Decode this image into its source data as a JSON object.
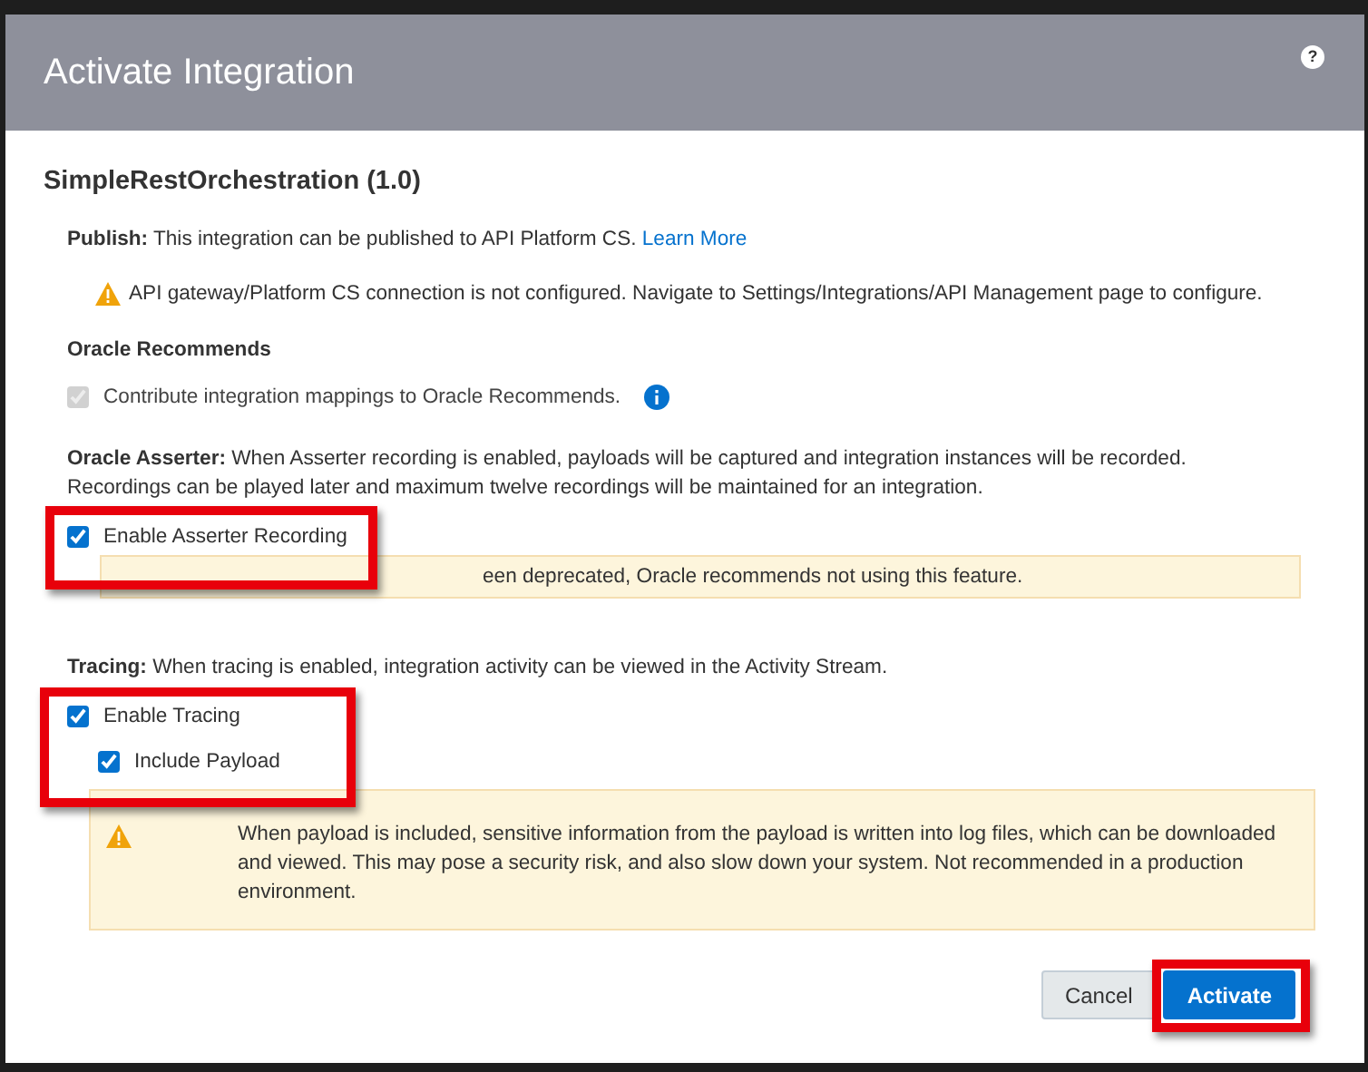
{
  "dialog": {
    "title": "Activate Integration",
    "help_icon": "?",
    "integration_name": "SimpleRestOrchestration (1.0)",
    "publish": {
      "text": "**Publish:** This integration can be published to API Platform CS.",
      "link": "Learn More",
      "warning": "API gateway/Platform CS connection is not configured. Navigate to Settings/Integrations/API Management page to configure."
    },
    "oracle_recommends": {
      "heading": "Oracle Recommends",
      "option": {
        "label": "Contribute integration mappings to Oracle Recommends.",
        "checked": true,
        "disabled": true
      }
    },
    "asserter": {
      "text": "**Oracle Asserter:** When Asserter recording is enabled, payloads will be captured and integration instances will be recorded. Recordings can be played later and maximum twelve recordings will be maintained for an integration.",
      "option": {
        "label": "Enable Asserter Recording",
        "checked": true,
        "disabled": false
      },
      "warning": "een deprecated, Oracle recommends not using this feature."
    },
    "tracing": {
      "text": "**Tracing:** When tracing is enabled, integration activity can be viewed in the Activity Stream.",
      "option": {
        "label": "Enable Tracing",
        "checked": true,
        "disabled": false
      },
      "sub_option": {
        "label": "Include Payload",
        "checked": true,
        "disabled": false
      },
      "warning": "When payload is included, sensitive information from the payload is written into log files, which can be downloaded and viewed. This may pose a security risk, and also slow down your system. Not recommended in a production environment."
    },
    "buttons": [
      {
        "label": "Cancel",
        "kind": "secondary"
      },
      {
        "label": "Activate",
        "kind": "primary"
      }
    ]
  }
}
